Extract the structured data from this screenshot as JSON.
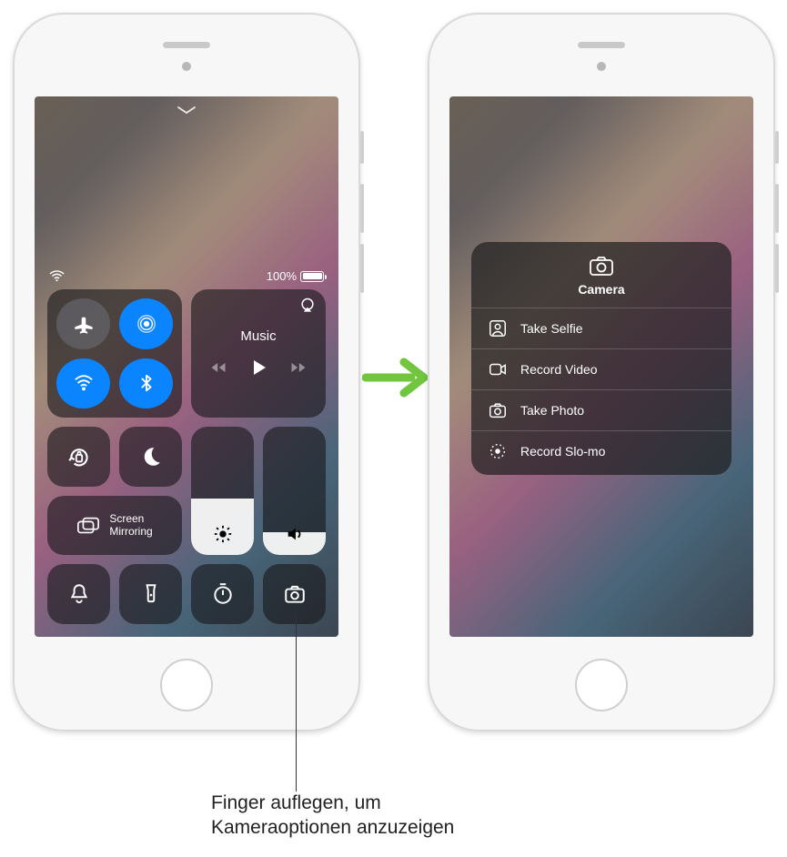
{
  "status": {
    "battery_text": "100%"
  },
  "control_center": {
    "music_label": "Music",
    "mirror_label": "Screen\nMirroring"
  },
  "camera_menu": {
    "title": "Camera",
    "items": [
      {
        "label": "Take Selfie"
      },
      {
        "label": "Record Video"
      },
      {
        "label": "Take Photo"
      },
      {
        "label": "Record Slo-mo"
      }
    ]
  },
  "callout": {
    "line1": "Finger auflegen, um",
    "line2": "Kameraoptionen anzuzeigen"
  }
}
